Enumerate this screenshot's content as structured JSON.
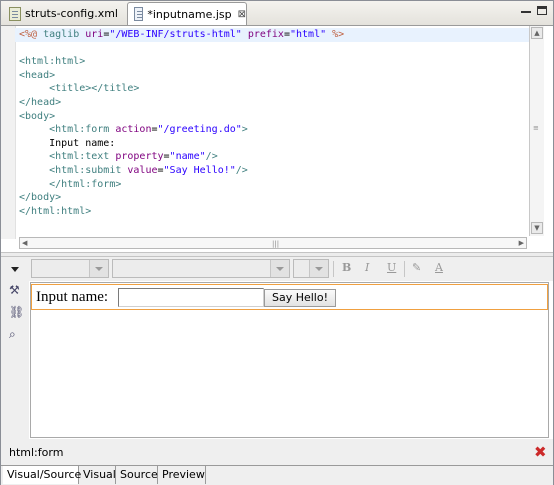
{
  "tabs": [
    {
      "label": "struts-config.xml"
    },
    {
      "label": "*inputname.jsp",
      "close": "⊠"
    }
  ],
  "source_lines": [
    {
      "current": true,
      "tokens": [
        {
          "c": "dir",
          "t": "<%@ "
        },
        {
          "c": "tag",
          "t": "taglib "
        },
        {
          "c": "attr",
          "t": "uri"
        },
        {
          "c": "",
          "t": "="
        },
        {
          "c": "val",
          "t": "\"/WEB-INF/struts-html\""
        },
        {
          "c": "",
          "t": " "
        },
        {
          "c": "attr",
          "t": "prefix"
        },
        {
          "c": "",
          "t": "="
        },
        {
          "c": "val",
          "t": "\"html\""
        },
        {
          "c": "",
          "t": " "
        },
        {
          "c": "dir",
          "t": "%>"
        }
      ]
    },
    {
      "tokens": []
    },
    {
      "tokens": [
        {
          "c": "tag",
          "t": "<html:html>"
        }
      ]
    },
    {
      "tokens": [
        {
          "c": "tag",
          "t": "<head>"
        }
      ]
    },
    {
      "tokens": [
        {
          "c": "",
          "t": "     "
        },
        {
          "c": "tag",
          "t": "<title></title>"
        }
      ]
    },
    {
      "tokens": [
        {
          "c": "tag",
          "t": "</head>"
        }
      ]
    },
    {
      "tokens": [
        {
          "c": "tag",
          "t": "<body>"
        }
      ]
    },
    {
      "tokens": [
        {
          "c": "",
          "t": "     "
        },
        {
          "c": "tag",
          "t": "<html:form "
        },
        {
          "c": "attr",
          "t": "action"
        },
        {
          "c": "",
          "t": "="
        },
        {
          "c": "val",
          "t": "\"/greeting.do\""
        },
        {
          "c": "tag",
          "t": ">"
        }
      ]
    },
    {
      "tokens": [
        {
          "c": "",
          "t": "     Input name:"
        }
      ]
    },
    {
      "tokens": [
        {
          "c": "",
          "t": "     "
        },
        {
          "c": "tag",
          "t": "<html:text "
        },
        {
          "c": "attr",
          "t": "property"
        },
        {
          "c": "",
          "t": "="
        },
        {
          "c": "val",
          "t": "\"name\""
        },
        {
          "c": "tag",
          "t": "/>"
        }
      ]
    },
    {
      "tokens": [
        {
          "c": "",
          "t": "     "
        },
        {
          "c": "tag",
          "t": "<html:submit "
        },
        {
          "c": "attr",
          "t": "value"
        },
        {
          "c": "",
          "t": "="
        },
        {
          "c": "val",
          "t": "\"Say Hello!\""
        },
        {
          "c": "tag",
          "t": "/>"
        }
      ]
    },
    {
      "tokens": [
        {
          "c": "",
          "t": "     "
        },
        {
          "c": "tag",
          "t": "</html:form>"
        }
      ]
    },
    {
      "tokens": [
        {
          "c": "tag",
          "t": "</body>"
        }
      ]
    },
    {
      "tokens": [
        {
          "c": "tag",
          "t": "</html:html>"
        }
      ]
    }
  ],
  "toolbar": {
    "bold": "B",
    "italic": "I",
    "underline": "U",
    "font_color": "A"
  },
  "preview": {
    "label": "Input name:",
    "input_value": "",
    "submit_label": "Say Hello!"
  },
  "status": {
    "selected_tag": "html:form",
    "close_icon": "✖"
  },
  "bottom_tabs": [
    {
      "label": "Visual/Source",
      "active": true
    },
    {
      "label": "Visual"
    },
    {
      "label": "Source"
    },
    {
      "label": "Preview"
    }
  ],
  "icons": {
    "tab_close": "close-icon",
    "minimize": "minimize-icon",
    "maximize": "maximize-icon",
    "tools": [
      "tools-icon",
      "link-icon",
      "find-icon"
    ]
  }
}
